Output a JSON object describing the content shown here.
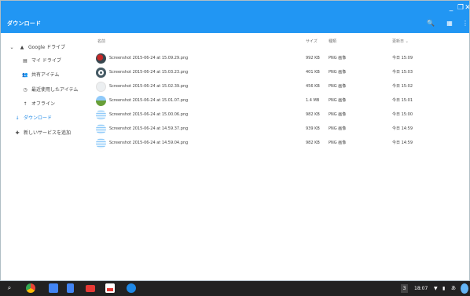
{
  "window": {
    "title": "ダウンロード",
    "minimize": "_",
    "restore": "❐",
    "close": "✕",
    "search_icon": "🔍",
    "grid_icon": "▦",
    "menu_icon": "⋮"
  },
  "sidebar": {
    "items": [
      {
        "label": "Google ドライブ",
        "icon": "▲"
      },
      {
        "label": "マイ ドライブ",
        "icon": "▤"
      },
      {
        "label": "共有アイテム",
        "icon": "👥"
      },
      {
        "label": "最近使用したアイテム",
        "icon": "◷"
      },
      {
        "label": "オフライン",
        "icon": "↑"
      },
      {
        "label": "ダウンロード",
        "icon": "↓"
      },
      {
        "label": "新しいサービスを追加",
        "icon": "✚"
      }
    ],
    "expand_icon": "⌄"
  },
  "columns": {
    "name": "名前",
    "size": "サイズ",
    "type": "種類",
    "modified": "更新日 ⌄"
  },
  "files": [
    {
      "name": "Screenshot 2015-06-24 at 15.09.29.png",
      "size": "992 KB",
      "type": "PNG 画像",
      "modified": "今日 15:09"
    },
    {
      "name": "Screenshot 2015-06-24 at 15.03.23.png",
      "size": "401 KB",
      "type": "PNG 画像",
      "modified": "今日 15:03"
    },
    {
      "name": "Screenshot 2015-06-24 at 15.02.39.png",
      "size": "456 KB",
      "type": "PNG 画像",
      "modified": "今日 15:02"
    },
    {
      "name": "Screenshot 2015-06-24 at 15.01.07.png",
      "size": "1.4 MB",
      "type": "PNG 画像",
      "modified": "今日 15:01"
    },
    {
      "name": "Screenshot 2015-06-24 at 15.00.06.png",
      "size": "982 KB",
      "type": "PNG 画像",
      "modified": "今日 15:00"
    },
    {
      "name": "Screenshot 2015-06-24 at 14.59.37.png",
      "size": "939 KB",
      "type": "PNG 画像",
      "modified": "今日 14:59"
    },
    {
      "name": "Screenshot 2015-06-24 at 14.59.04.png",
      "size": "982 KB",
      "type": "PNG 画像",
      "modified": "今日 14:59"
    }
  ],
  "taskbar": {
    "launcher_icon": "⌕",
    "badge": "3",
    "time": "18:07",
    "wifi_icon": "▼",
    "battery_icon": "▮",
    "ime": "あ"
  },
  "colors": {
    "accent": "#2196f3",
    "taskbar": "#222222"
  }
}
